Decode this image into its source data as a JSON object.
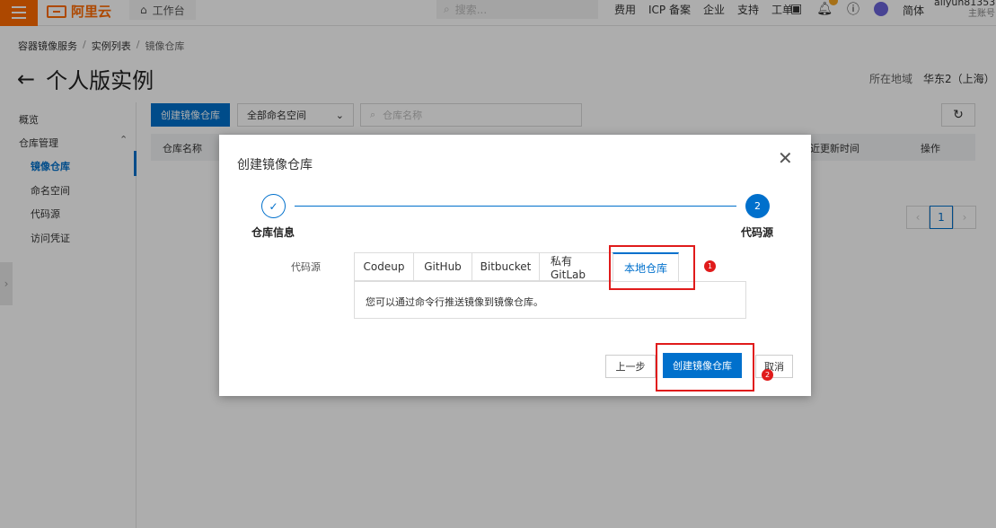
{
  "topbar": {
    "brand": "阿里云",
    "workbench": "工作台",
    "search_placeholder": "搜索...",
    "links": [
      "费用",
      "ICP 备案",
      "企业",
      "支持",
      "工单"
    ],
    "lang": "简体",
    "user_name": "aliyun813536...",
    "user_sub": "主账号",
    "accent": "#ff6a00"
  },
  "breadcrumb": [
    "容器镜像服务",
    "实例列表",
    "镜像仓库"
  ],
  "page": {
    "title": "个人版实例",
    "region_label": "所在地域",
    "region_value": "华东2（上海）"
  },
  "sidebar": {
    "items": [
      {
        "label": "概览"
      },
      {
        "label": "仓库管理"
      },
      {
        "label": "镜像仓库"
      },
      {
        "label": "命名空间"
      },
      {
        "label": "代码源"
      },
      {
        "label": "访问凭证"
      }
    ]
  },
  "toolbar": {
    "create_label": "创建镜像仓库",
    "namespace_select": "全部命名空间",
    "repo_search_placeholder": "仓库名称"
  },
  "table": {
    "col_name": "仓库名称",
    "col_updated": "近更新时间",
    "col_action": "操作"
  },
  "pager": {
    "current": "1"
  },
  "dialog": {
    "title": "创建镜像仓库",
    "step1_label": "仓库信息",
    "step2_label": "代码源",
    "step2_number": "2",
    "source_label": "代码源",
    "tabs": [
      "Codeup",
      "GitHub",
      "Bitbucket",
      "私有GitLab",
      "本地仓库"
    ],
    "active_tab": "本地仓库",
    "tab_content": "您可以通过命令行推送镜像到镜像仓库。",
    "btn_prev": "上一步",
    "btn_create": "创建镜像仓库",
    "btn_cancel": "取消",
    "annotation_1": "1",
    "annotation_2": "2",
    "primary_color": "#0070cc",
    "annotation_color": "#e01b1b"
  }
}
